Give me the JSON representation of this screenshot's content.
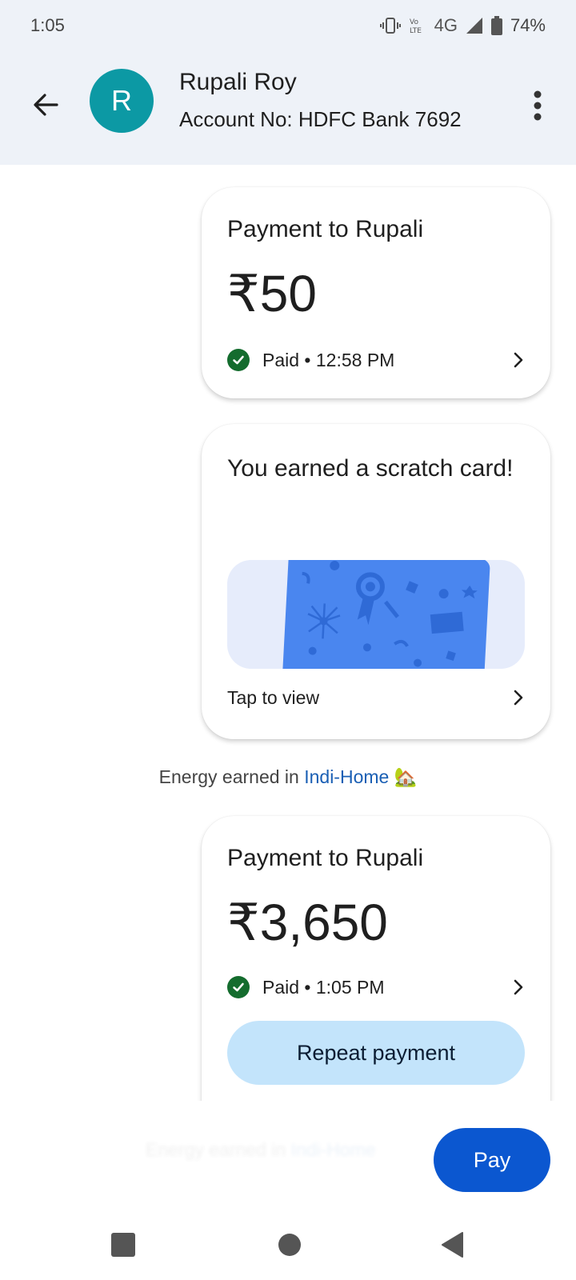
{
  "status_bar": {
    "time": "1:05",
    "network": "4G",
    "battery": "74%",
    "icons": [
      "vibrate-icon",
      "volte-icon",
      "signal-icon",
      "battery-icon"
    ]
  },
  "header": {
    "avatar_letter": "R",
    "name": "Rupali Roy",
    "account": "Account No: HDFC Bank 7692",
    "avatar_color": "#0c99a4"
  },
  "messages": [
    {
      "title": "Payment to Rupali",
      "amount": "₹50",
      "status": "Paid • 12:58 PM"
    },
    {
      "title": "You earned a scratch card!",
      "action": "Tap to view"
    },
    {
      "title": "Payment to Rupali",
      "amount": "₹3,650",
      "status": "Paid • 1:05 PM",
      "button": "Repeat payment"
    }
  ],
  "energy": {
    "prefix": "Energy earned in ",
    "link": "Indi-Home",
    "emoji": "🏡"
  },
  "pay_button": "Pay",
  "colors": {
    "header_bg": "#eef2f8",
    "paid_green": "#146c2e",
    "pay_blue": "#0b57d0",
    "repeat_bg": "#c3e4fb",
    "scratch_blue": "#4a86ef",
    "link_blue": "#1a5fb4"
  }
}
